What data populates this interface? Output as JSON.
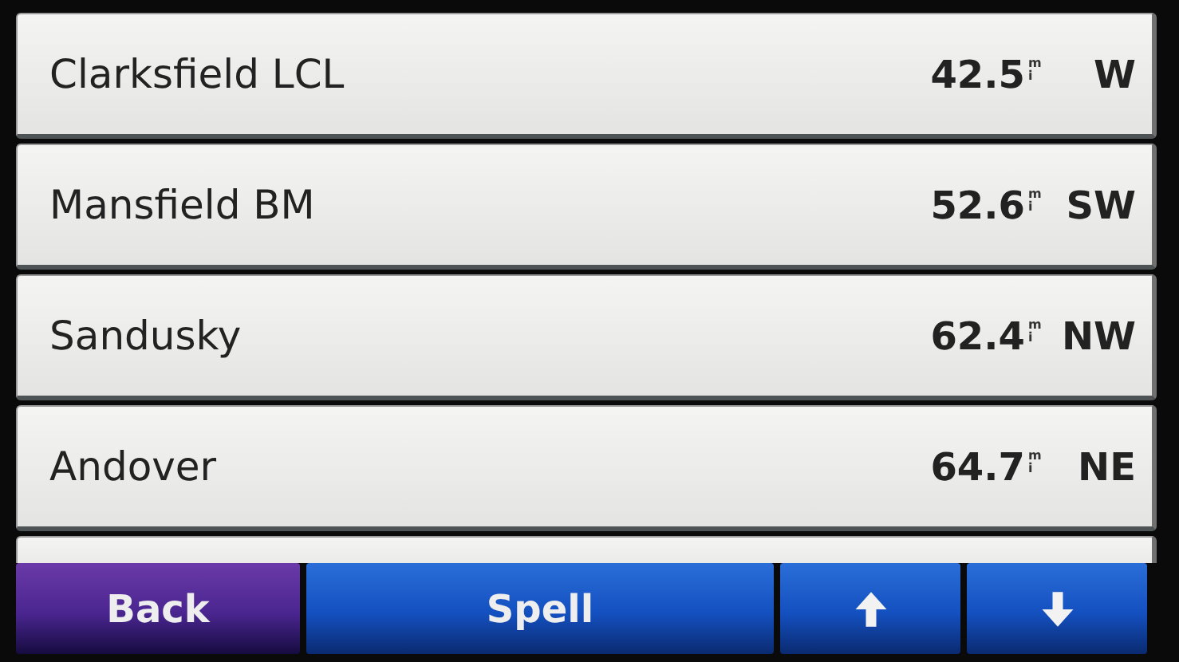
{
  "rows": [
    {
      "name": "Clarksfield LCL",
      "distance": "42.5",
      "unit": "mi",
      "direction": "W"
    },
    {
      "name": "Mansfield BM",
      "distance": "52.6",
      "unit": "mi",
      "direction": "SW"
    },
    {
      "name": "Sandusky",
      "distance": "62.4",
      "unit": "mi",
      "direction": "NW"
    },
    {
      "name": "Andover",
      "distance": "64.7",
      "unit": "mi",
      "direction": "NE"
    }
  ],
  "buttons": [
    {
      "kind": "back",
      "label": "Back"
    },
    {
      "kind": "spell",
      "label": "Spell"
    },
    {
      "kind": "up"
    },
    {
      "kind": "down"
    }
  ]
}
